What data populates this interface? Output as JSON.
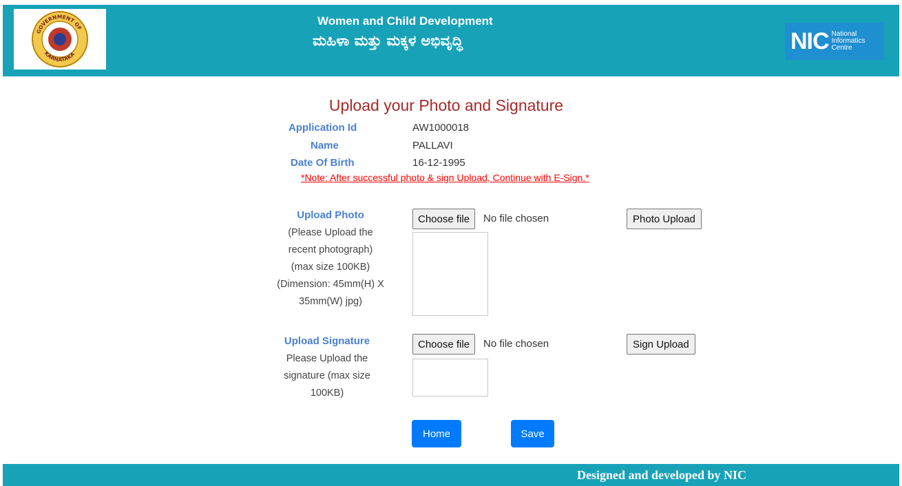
{
  "header": {
    "title_en": "Women and Child Development",
    "title_kn": "ಮಹಿಳಾ ಮತ್ತು ಮಕ್ಕಳ ಅಭಿವೃದ್ಧಿ",
    "left_logo": {
      "name": "government-of-karnataka-emblem",
      "text_top": "GOVERNMENT OF",
      "text_bottom": "KARNATAKA"
    },
    "right_logo": {
      "name": "nic-logo",
      "letters": "NIC",
      "line1": "National",
      "line2": "Informatics",
      "line3": "Centre"
    },
    "bg_color": "#17a2b8"
  },
  "page": {
    "title": "Upload your Photo and Signature",
    "fields": [
      {
        "label": "Application Id",
        "value": "AW1000018"
      },
      {
        "label": "Name",
        "value": "PALLAVI"
      },
      {
        "label": "Date Of Birth",
        "value": "16-12-1995"
      }
    ],
    "note": "*Note: After successful photo & sign Upload, Continue with E-Sign.*"
  },
  "photo": {
    "label": "Upload Photo",
    "help": [
      "(Please Upload the",
      "recent photograph)",
      "(max size 100KB)",
      "(Dimension: 45mm(H) X",
      "35mm(W) jpg)"
    ],
    "choose_label": "Choose file",
    "status": "No file chosen",
    "upload_label": "Photo Upload"
  },
  "signature": {
    "label": "Upload Signature",
    "help": [
      "Please Upload the",
      "signature (max size",
      "100KB)"
    ],
    "choose_label": "Choose file",
    "status": "No file chosen",
    "upload_label": "Sign Upload"
  },
  "actions": {
    "home_label": "Home",
    "save_label": "Save"
  },
  "footer": {
    "text": "Designed and developed by NIC"
  }
}
